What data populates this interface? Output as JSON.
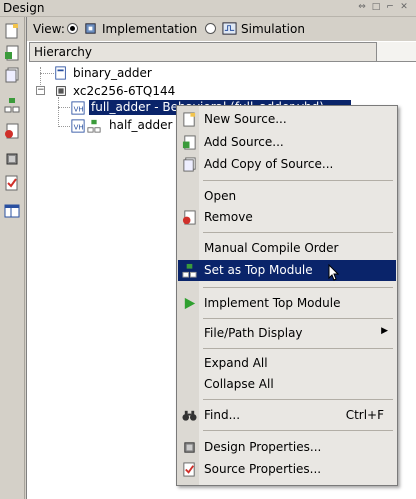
{
  "window": {
    "title": "Design"
  },
  "view": {
    "label": "View:",
    "option_impl": "Implementation",
    "option_sim": "Simulation"
  },
  "hierarchy": {
    "header": "Hierarchy"
  },
  "tree": {
    "items": [
      {
        "label": "binary_adder"
      },
      {
        "label": "xc2c256-6TQ144"
      },
      {
        "label": "full_adder - Behavioral (full_adder.vhd)"
      },
      {
        "label": "half_adder"
      }
    ]
  },
  "menu": {
    "new_source": "New Source...",
    "add_source": "Add Source...",
    "add_copy": "Add Copy of Source...",
    "open": "Open",
    "remove": "Remove",
    "manual_compile": "Manual Compile Order",
    "set_top": "Set as Top Module",
    "implement_top": "Implement Top Module",
    "file_path": "File/Path Display",
    "expand_all": "Expand All",
    "collapse_all": "Collapse All",
    "find": "Find...",
    "find_shortcut": "Ctrl+F",
    "design_props": "Design Properties...",
    "source_props": "Source Properties..."
  }
}
